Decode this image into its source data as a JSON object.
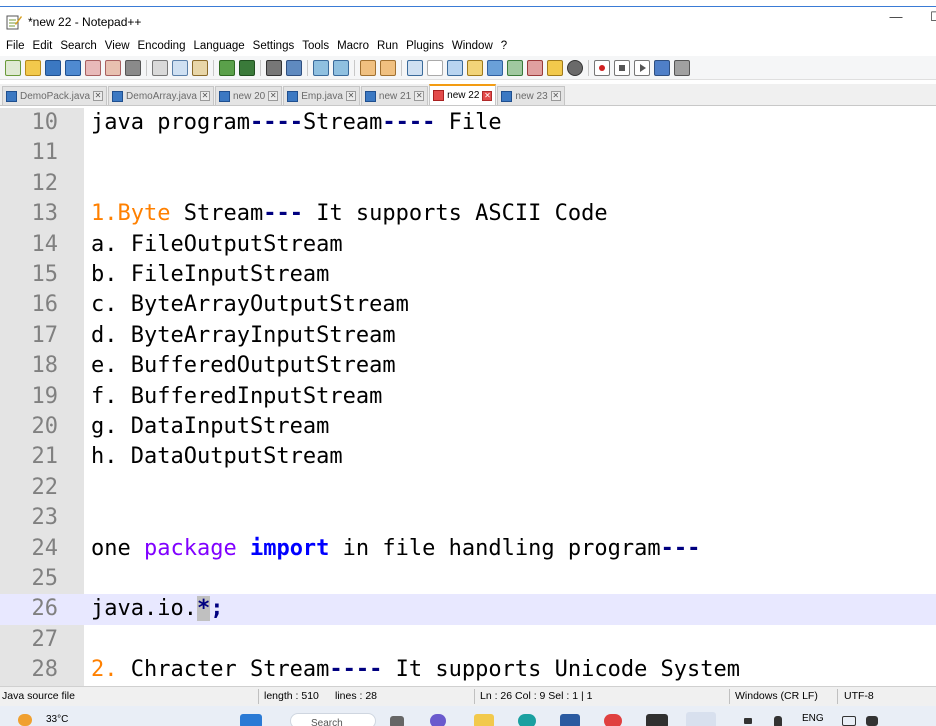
{
  "window": {
    "title": "*new 22 - Notepad++",
    "minimize": "—",
    "maximize": "☐"
  },
  "menu": [
    "File",
    "Edit",
    "Search",
    "View",
    "Encoding",
    "Language",
    "Settings",
    "Tools",
    "Macro",
    "Run",
    "Plugins",
    "Window",
    "?"
  ],
  "tabs": [
    {
      "label": "DemoPack.java",
      "active": false
    },
    {
      "label": "DemoArray.java",
      "active": false
    },
    {
      "label": "new 20",
      "active": false
    },
    {
      "label": "Emp.java",
      "active": false
    },
    {
      "label": "new 21",
      "active": false
    },
    {
      "label": "new 22",
      "active": true
    },
    {
      "label": "new 23",
      "active": false
    }
  ],
  "tab_close": "✕",
  "editor": {
    "current_line": 26,
    "lines": [
      {
        "num": "10",
        "segments": [
          {
            "t": "java program",
            "c": "plain"
          },
          {
            "t": "----",
            "c": "op"
          },
          {
            "t": "Stream",
            "c": "plain"
          },
          {
            "t": "----",
            "c": "op"
          },
          {
            "t": " File",
            "c": "plain"
          }
        ]
      },
      {
        "num": "11",
        "segments": []
      },
      {
        "num": "12",
        "segments": []
      },
      {
        "num": "13",
        "segments": [
          {
            "t": "1.",
            "c": "num"
          },
          {
            "t": "Byte",
            "c": "num"
          },
          {
            "t": " Stream",
            "c": "plain"
          },
          {
            "t": "---",
            "c": "op"
          },
          {
            "t": " It supports ASCII Code",
            "c": "plain"
          }
        ]
      },
      {
        "num": "14",
        "segments": [
          {
            "t": "a. FileOutputStream",
            "c": "plain"
          }
        ]
      },
      {
        "num": "15",
        "segments": [
          {
            "t": "b. FileInputStream",
            "c": "plain"
          }
        ]
      },
      {
        "num": "16",
        "segments": [
          {
            "t": "c. ByteArrayOutputStream",
            "c": "plain"
          }
        ]
      },
      {
        "num": "17",
        "segments": [
          {
            "t": "d. ByteArrayInputStream",
            "c": "plain"
          }
        ]
      },
      {
        "num": "18",
        "segments": [
          {
            "t": "e. BufferedOutputStream",
            "c": "plain"
          }
        ]
      },
      {
        "num": "19",
        "segments": [
          {
            "t": "f. BufferedInputStream",
            "c": "plain"
          }
        ]
      },
      {
        "num": "20",
        "segments": [
          {
            "t": "g. DataInputStream",
            "c": "plain"
          }
        ]
      },
      {
        "num": "21",
        "segments": [
          {
            "t": "h. DataOutputStream",
            "c": "plain"
          }
        ]
      },
      {
        "num": "22",
        "segments": []
      },
      {
        "num": "23",
        "segments": []
      },
      {
        "num": "24",
        "segments": [
          {
            "t": "one ",
            "c": "plain"
          },
          {
            "t": "package",
            "c": "pkg"
          },
          {
            "t": " ",
            "c": "plain"
          },
          {
            "t": "import",
            "c": "kw"
          },
          {
            "t": " in file handling program",
            "c": "plain"
          },
          {
            "t": "---",
            "c": "op"
          }
        ]
      },
      {
        "num": "25",
        "segments": []
      },
      {
        "num": "26",
        "segments": [
          {
            "t": "java.io.",
            "c": "plain"
          },
          {
            "t": "*",
            "c": "sel"
          },
          {
            "t": ";",
            "c": "op"
          }
        ]
      },
      {
        "num": "27",
        "segments": []
      },
      {
        "num": "28",
        "segments": [
          {
            "t": "2.",
            "c": "num"
          },
          {
            "t": " Chracter Stream",
            "c": "plain"
          },
          {
            "t": "----",
            "c": "op"
          },
          {
            "t": " It supports Unicode System",
            "c": "plain"
          }
        ]
      }
    ]
  },
  "status": {
    "filetype": "Java source file",
    "length": "length : 510",
    "lines": "lines : 28",
    "position": "Ln : 26    Col : 9    Sel : 1 | 1",
    "eol": "Windows (CR LF)",
    "encoding": "UTF-8"
  },
  "taskbar": {
    "weather": "33°C",
    "search": "Search",
    "lang": "ENG"
  },
  "colors": {
    "number": "#ff8000",
    "operator": "#000080",
    "package": "#8000ff",
    "keyword": "#0000ff",
    "current_line": "#e8e8ff",
    "gutter": "#e4e4e4"
  }
}
